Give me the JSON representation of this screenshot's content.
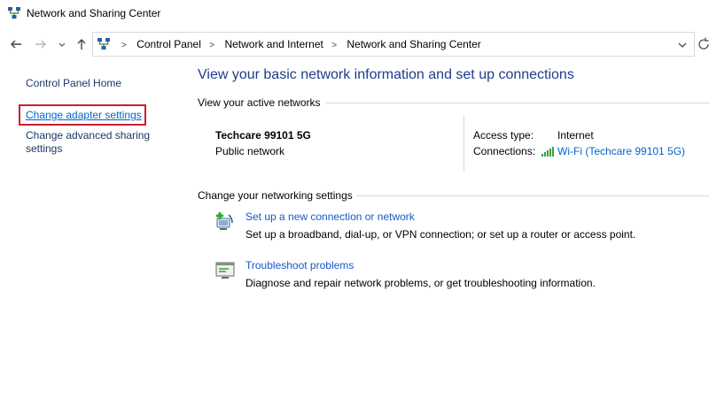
{
  "window": {
    "title": "Network and Sharing Center"
  },
  "address_bar": {
    "crumbs": [
      "Control Panel",
      "Network and Internet",
      "Network and Sharing Center"
    ]
  },
  "left_pane": {
    "home": "Control Panel Home",
    "adapter": "Change adapter settings",
    "advanced": "Change advanced sharing settings"
  },
  "main": {
    "title": "View your basic network information and set up connections",
    "active_header": "View your active networks",
    "network": {
      "name": "Techcare 99101 5G",
      "category": "Public network",
      "access_label": "Access type:",
      "access_value": "Internet",
      "connections_label": "Connections:",
      "connection_link": "Wi-Fi (Techcare 99101 5G)"
    },
    "change_header": "Change your networking settings",
    "tasks": [
      {
        "link": "Set up a new connection or network",
        "desc": "Set up a broadband, dial-up, or VPN connection; or set up a router or access point."
      },
      {
        "link": "Troubleshoot problems",
        "desc": "Diagnose and repair network problems, or get troubleshooting information."
      }
    ]
  },
  "icons": {
    "app": "network-icon",
    "back": "arrow-left-icon",
    "forward": "arrow-right-icon",
    "up": "arrow-up-icon",
    "wifi": "wifi-signal-icon",
    "setup": "new-connection-icon",
    "troubleshoot": "troubleshoot-icon"
  },
  "colors": {
    "link": "#0066cc",
    "title": "#1e3d8a",
    "highlight": "#cc1f2b"
  }
}
